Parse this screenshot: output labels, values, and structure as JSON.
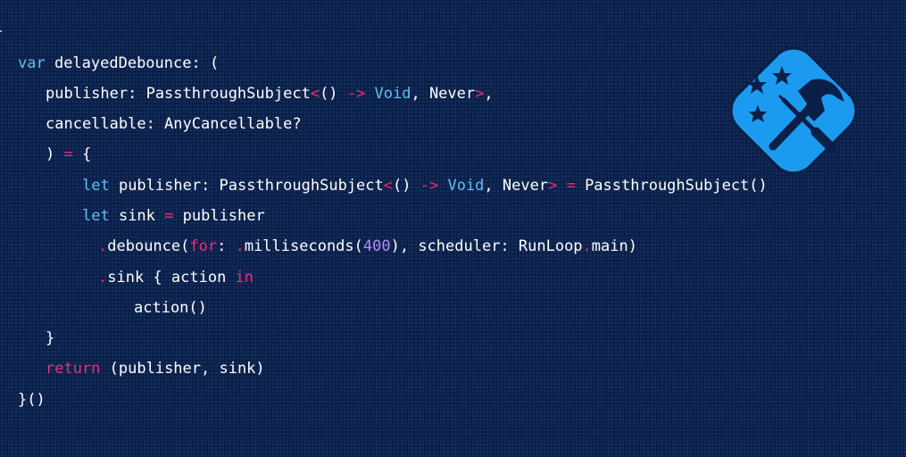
{
  "code": {
    "lines": [
      {
        "tokens": [
          [
            "var",
            "kw"
          ],
          [
            " delayedDebounce: (",
            "plain"
          ]
        ]
      },
      {
        "tokens": [
          [
            "publisher: PassthroughSubject",
            "plain"
          ],
          [
            "<",
            "pink"
          ],
          [
            "() ",
            "plain"
          ],
          [
            "->",
            "pink"
          ],
          [
            " ",
            "plain"
          ],
          [
            "Void",
            "type"
          ],
          [
            ", Never",
            "plain"
          ],
          [
            ">",
            "pink"
          ],
          [
            ",",
            "plain"
          ]
        ]
      },
      {
        "tokens": [
          [
            "cancellable: AnyCancellable?",
            "plain"
          ]
        ]
      },
      {
        "tokens": [
          [
            ") ",
            "plain"
          ],
          [
            "=",
            "pink"
          ],
          [
            " {",
            "plain"
          ]
        ]
      },
      {
        "tokens": [
          [
            "let",
            "kw"
          ],
          [
            " publisher: PassthroughSubject",
            "plain"
          ],
          [
            "<",
            "pink"
          ],
          [
            "() ",
            "plain"
          ],
          [
            "->",
            "pink"
          ],
          [
            " ",
            "plain"
          ],
          [
            "Void",
            "type"
          ],
          [
            ", Never",
            "plain"
          ],
          [
            ">",
            "pink"
          ],
          [
            " ",
            "plain"
          ],
          [
            "=",
            "pink"
          ],
          [
            " PassthroughSubject()",
            "plain"
          ]
        ]
      },
      {
        "tokens": [
          [
            "let",
            "kw"
          ],
          [
            " sink ",
            "plain"
          ],
          [
            "=",
            "pink"
          ],
          [
            " publisher",
            "plain"
          ]
        ]
      },
      {
        "tokens": [
          [
            ".",
            "pink"
          ],
          [
            "debounce(",
            "plain"
          ],
          [
            "for",
            "pink"
          ],
          [
            ": ",
            "plain"
          ],
          [
            ".",
            "pink"
          ],
          [
            "milliseconds(",
            "plain"
          ],
          [
            "400",
            "num"
          ],
          [
            "), scheduler: RunLoop",
            "plain"
          ],
          [
            ".",
            "pink"
          ],
          [
            "main)",
            "plain"
          ]
        ]
      },
      {
        "tokens": [
          [
            ".",
            "pink"
          ],
          [
            "sink { action ",
            "plain"
          ],
          [
            "in",
            "pink"
          ]
        ]
      },
      {
        "tokens": [
          [
            "action()",
            "plain"
          ]
        ]
      },
      {
        "tokens": [
          [
            "}",
            "plain"
          ]
        ]
      },
      {
        "tokens": [
          [
            "return",
            "pink"
          ],
          [
            " (publisher, sink)",
            "plain"
          ]
        ]
      },
      {
        "tokens": [
          [
            "}()",
            "plain"
          ]
        ]
      }
    ]
  },
  "logo": {
    "name": "hammer-screwdriver-stars-icon",
    "background_color": "#1c9af0",
    "border_color": "#0b2049",
    "glyph_color": "#0b2049"
  },
  "colors": {
    "background": "#0b2049",
    "keyword": "#5ec0f0",
    "operator": "#f02a78",
    "number": "#b48cf5",
    "text": "#ffffff"
  }
}
